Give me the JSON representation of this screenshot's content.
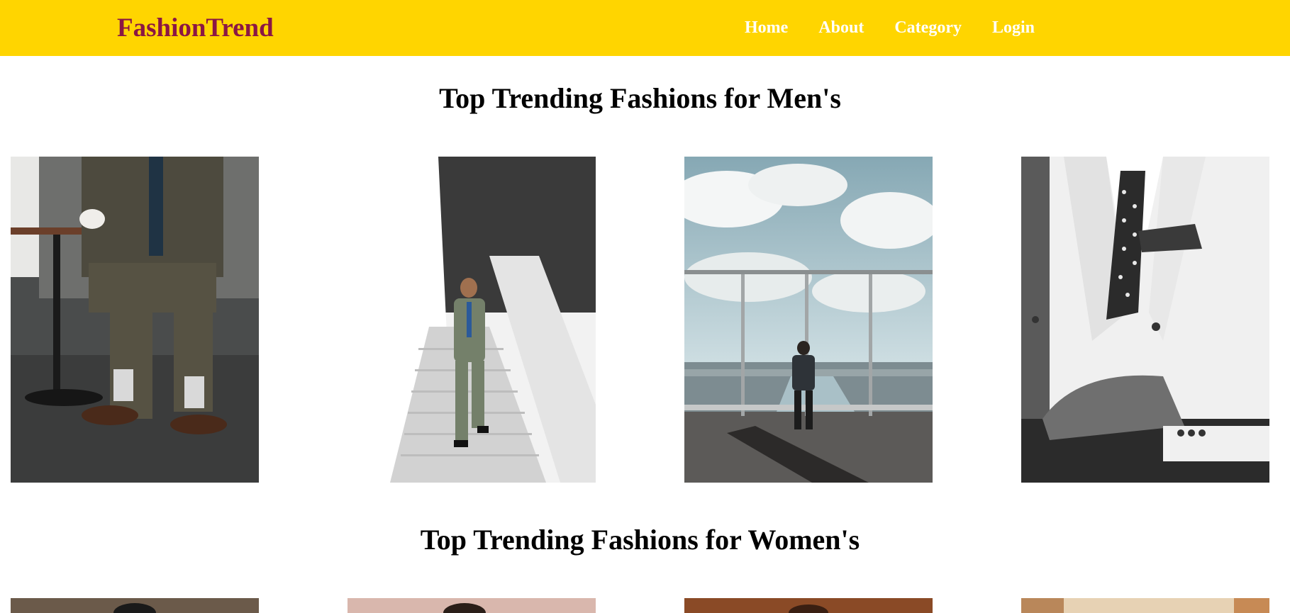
{
  "header": {
    "brand": "FashionTrend",
    "nav": [
      "Home",
      "About",
      "Category",
      "Login"
    ],
    "colors": {
      "bar": "#FFD500",
      "brand": "#8B1744",
      "nav_text": "#FFFFFF"
    }
  },
  "sections": [
    {
      "title": "Top Trending Fashions for Men's",
      "images": [
        "man in olive suit seated at cafe table with coffee cup",
        "man in green suit descending white staircase",
        "man looking out over city from observation deck",
        "black and white close-up of white double-breasted suit"
      ]
    },
    {
      "title": "Top Trending Fashions for Women's",
      "images": [
        "women fashion photo 1",
        "women fashion photo 2",
        "women fashion photo 3",
        "women fashion photo 4"
      ]
    }
  ]
}
